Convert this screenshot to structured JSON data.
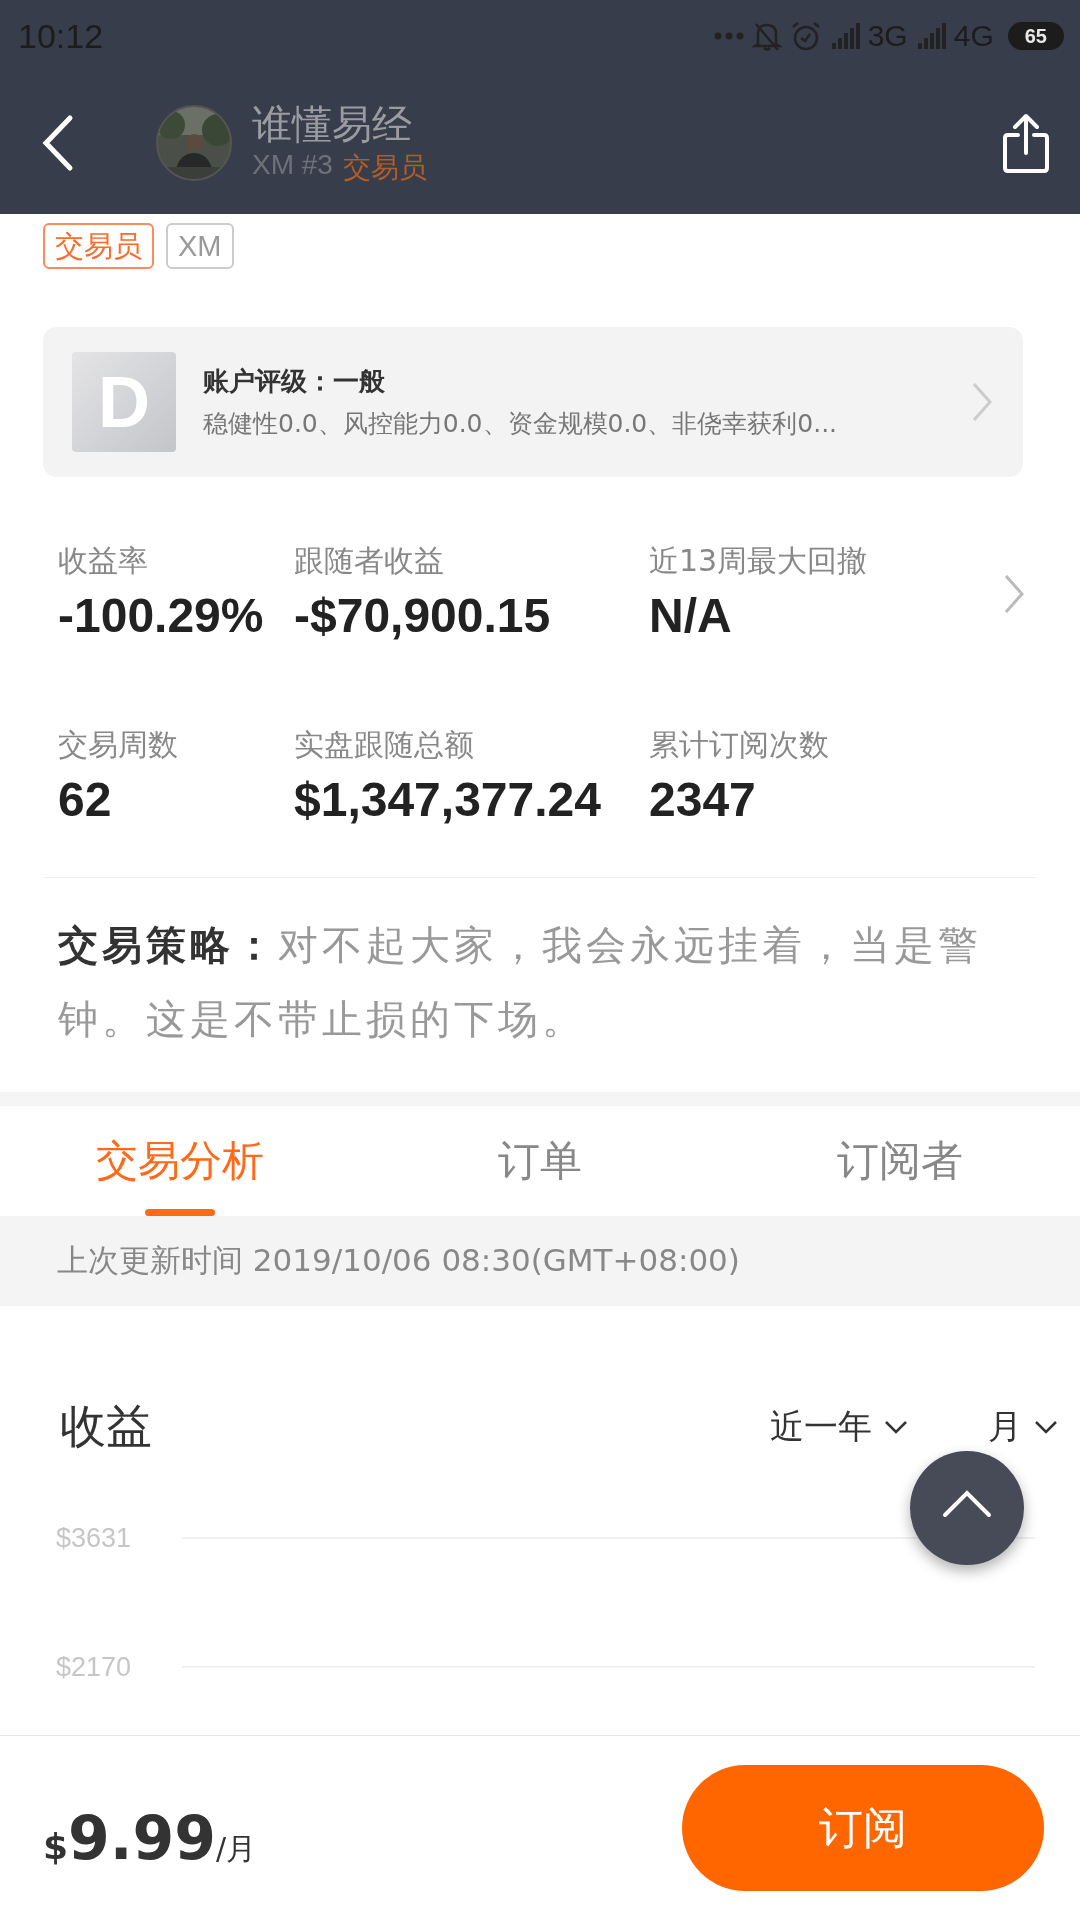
{
  "status_bar": {
    "time": "10:12",
    "network_1": "3G",
    "network_2": "4G",
    "battery": "65"
  },
  "header": {
    "name": "谁懂易经",
    "broker": "XM #3",
    "role": "交易员"
  },
  "tags": [
    {
      "label": "交易员",
      "kind": "accent"
    },
    {
      "label": "XM",
      "kind": "plain"
    }
  ],
  "rating": {
    "grade": "D",
    "title": "账户评级：一般",
    "details": "稳健性0.0、风控能力0.0、资金规模0.0、非侥幸获利0..."
  },
  "stats": [
    {
      "label": "收益率",
      "value": "-100.29%"
    },
    {
      "label": "跟随者收益",
      "value": "-$70,900.15"
    },
    {
      "label": "近13周最大回撤",
      "value": "N/A"
    },
    {
      "label": "交易周数",
      "value": "62"
    },
    {
      "label": "实盘跟随总额",
      "value": "$1,347,377.24"
    },
    {
      "label": "累计订阅次数",
      "value": "2347"
    }
  ],
  "strategy": {
    "label": "交易策略：",
    "text": "对不起大家，我会永远挂着，当是警钟。这是不带止损的下场。"
  },
  "tabs": [
    {
      "label": "交易分析",
      "selected": true
    },
    {
      "label": "订单",
      "selected": false
    },
    {
      "label": "订阅者",
      "selected": false
    }
  ],
  "update_time": "上次更新时间 2019/10/06 08:30(GMT+08:00)",
  "chart": {
    "title": "收益",
    "range": "近一年",
    "period": "月",
    "y_labels": [
      "$3631",
      "$2170"
    ]
  },
  "price": {
    "currency": "$",
    "amount": "9.99",
    "unit": "/月"
  },
  "subscribe_button": "订阅"
}
